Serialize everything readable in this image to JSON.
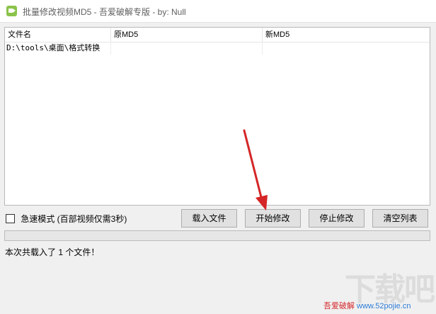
{
  "window": {
    "title": "批量修改视频MD5 - 吾爱破解专版 - by: Null"
  },
  "file_list": {
    "columns": [
      "文件名",
      "原MD5",
      "新MD5"
    ],
    "rows": [
      [
        "D:\\tools\\桌面\\格式转换",
        "",
        ""
      ]
    ]
  },
  "options": {
    "fast_mode_label": "急速模式 (百部视频仅需3秒)",
    "fast_mode_checked": false
  },
  "buttons": {
    "load": "载入文件",
    "start": "开始修改",
    "stop": "停止修改",
    "clear": "清空列表"
  },
  "progress": {
    "value": 0
  },
  "status": {
    "text": "本次共载入了 1 个文件！"
  },
  "watermark": {
    "logo": "下载吧",
    "left": "吾爱破解",
    "site": "www.52pojie.cn"
  },
  "colors": {
    "annotation_arrow": "#d42626",
    "app_icon": "#8bc34a"
  }
}
